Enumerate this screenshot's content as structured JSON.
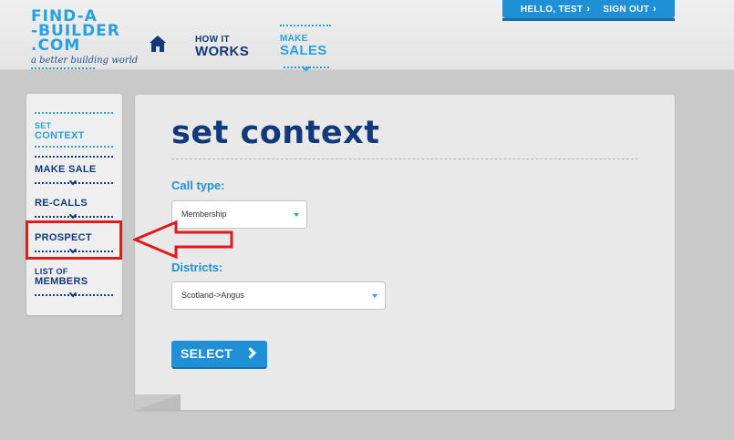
{
  "brand": {
    "logo_line1": "FIND-A",
    "logo_line2": "-BUILDER",
    "logo_line3": ".COM",
    "tagline": "a better building world",
    "primary_color": "#29a1e0",
    "dark_color": "#123a7a"
  },
  "header": {
    "home_icon": "home-icon",
    "nav": [
      {
        "small": "HOW IT",
        "big": "WORKS"
      },
      {
        "small": "MAKE",
        "big": "SALES"
      }
    ],
    "user": {
      "greeting": "HELLO, TEST",
      "signout": "SIGN OUT"
    }
  },
  "sidebar": {
    "items": [
      {
        "small": "SET",
        "big": "CONTEXT"
      },
      {
        "label": "MAKE SALE"
      },
      {
        "label": "RE-CALLS"
      },
      {
        "label": "PROSPECT"
      },
      {
        "small": "LIST OF",
        "big": "MEMBERS"
      }
    ]
  },
  "main": {
    "title": "set context",
    "call_type": {
      "label": "Call type:",
      "value": "Membership"
    },
    "districts": {
      "label": "Districts:",
      "value": "Scotland->Angus"
    },
    "submit_label": "SELECT"
  },
  "annotation": {
    "color": "#e01b1b"
  }
}
